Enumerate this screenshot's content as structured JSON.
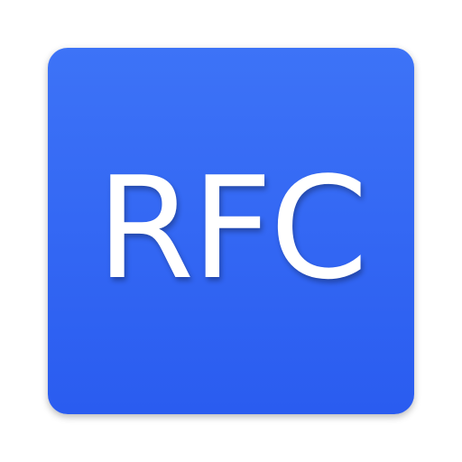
{
  "icon": {
    "label": "RFC",
    "background_color_top": "#3d73f7",
    "background_color_bottom": "#2a5cf0",
    "text_color": "#ffffff"
  }
}
